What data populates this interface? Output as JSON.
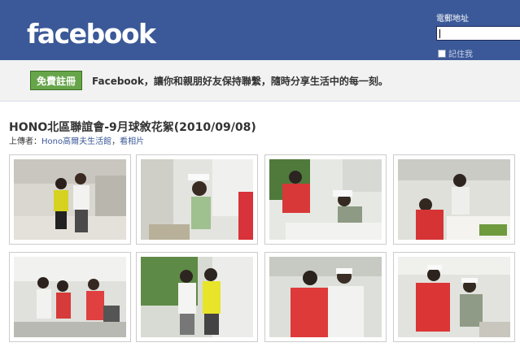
{
  "header": {
    "logo": "facebook",
    "email_label": "電郵地址",
    "remember_label": "記住我"
  },
  "bar": {
    "signup_label": "免費註冊",
    "tagline": "Facebook，讓你和親朋好友保持聯繫，隨時分享生活中的每一刻。"
  },
  "album": {
    "title": "HONO北區聯誼會-9月球敘花絮(2010/09/08)",
    "uploader_prefix": "上傳者：",
    "uploader_name": "Hono高爾夫生活館",
    "separator": "，",
    "view_photos": "看相片"
  },
  "colors": {
    "brand": "#3b5998",
    "signup_green": "#67a54b"
  }
}
